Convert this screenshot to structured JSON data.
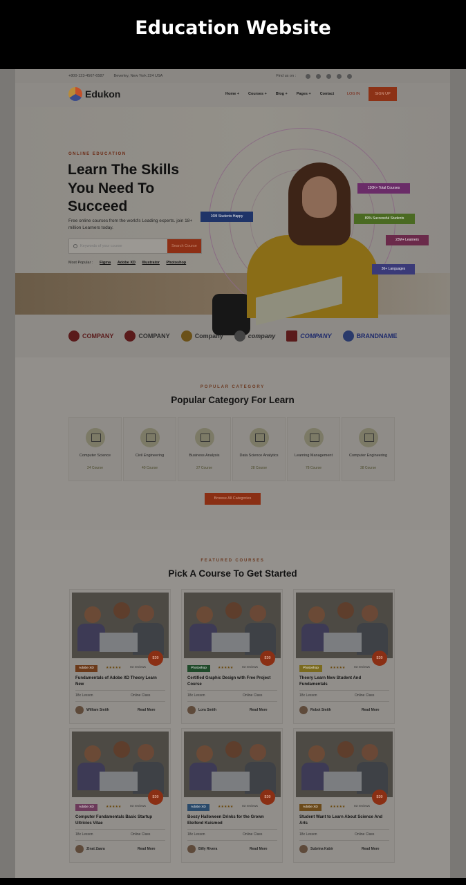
{
  "title_bar": "Education Website",
  "topbar": {
    "phone": "+800-123-4567-6587",
    "address": "Beverley, New York 224 USA",
    "find_us": "Find us on :"
  },
  "logo": "Edukon",
  "nav": [
    "Home +",
    "Courses +",
    "Blog +",
    "Pages +",
    "Contact"
  ],
  "login": "LOG IN",
  "signup": "SIGN UP",
  "hero": {
    "kicker": "ONLINE EDUCATION",
    "headline": "Learn The Skills You Need To Succeed",
    "lead": "Free online courses from the world's Leading experts. join 18+ million Learners today.",
    "search_placeholder": "Keywords of your course",
    "search_button": "Search Course",
    "popular_label": "Most Popular :",
    "popular": [
      "Figma",
      "Adobe XD",
      "Illustrator",
      "Photoshop"
    ],
    "tags": [
      "16M Students Happy",
      "130K+ Total Courses",
      "89% Successful Students",
      "23M+ Learners",
      "36+ Languages"
    ]
  },
  "brands": [
    "COMPANY",
    "COMPANY",
    "Company",
    "company",
    "COMPANY",
    "BRANDNAME"
  ],
  "categories": {
    "kicker": "POPULAR CATEGORY",
    "title": "Popular Category For Learn",
    "items": [
      {
        "name": "Computer Science",
        "count": "24 Course"
      },
      {
        "name": "Civil Engineering",
        "count": "40 Course"
      },
      {
        "name": "Business Analysis",
        "count": "27 Course"
      },
      {
        "name": "Data Science Analytics",
        "count": "28 Course"
      },
      {
        "name": "Learning Management",
        "count": "78 Course"
      },
      {
        "name": "Computer Engineering",
        "count": "38 Course"
      }
    ],
    "browse": "Browse All Categories"
  },
  "courses": {
    "kicker": "FEATURED COURSES",
    "title": "Pick A Course To Get Started",
    "items": [
      {
        "badge": "Adobe XD",
        "reviews": "03 reviews",
        "title": "Fundamentals of Adobe XD Theory Learn New",
        "lessons": "18x Lesson",
        "mode": "Online Class",
        "author": "William Smith",
        "more": "Read More",
        "price": "$30",
        "badge_color": "#6b3a1a"
      },
      {
        "badge": "Photoshop",
        "reviews": "03 reviews",
        "title": "Certified Graphic Design with Free Project Course",
        "lessons": "18x Lesson",
        "mode": "Online Class",
        "author": "Lora Smith",
        "more": "Read More",
        "price": "$30",
        "badge_color": "#1f4a2a"
      },
      {
        "badge": "Photoshop",
        "reviews": "03 reviews",
        "title": "Theory Learn New Student And Fundamentals",
        "lessons": "18x Lesson",
        "mode": "Online Class",
        "author": "Robot Smith",
        "more": "Read More",
        "price": "$30",
        "badge_color": "#7a6a1e"
      },
      {
        "badge": "Adobe XD",
        "reviews": "03 reviews",
        "title": "Computer Fundamentals Basic Startup Ultricies Vitae",
        "lessons": "18x Lesson",
        "mode": "Online Class",
        "author": "Zinat Zaara",
        "more": "Read More",
        "price": "$30",
        "badge_color": "#6b3a5a"
      },
      {
        "badge": "Adobe XD",
        "reviews": "03 reviews",
        "title": "Boozy Halloween Drinks for the Grown Eleifend Kuismod",
        "lessons": "18x Lesson",
        "mode": "Online Class",
        "author": "Billy Rivera",
        "more": "Read More",
        "price": "$30",
        "badge_color": "#2a4a6a"
      },
      {
        "badge": "Adobe XD",
        "reviews": "03 reviews",
        "title": "Student Want to Learn About Science And Arts",
        "lessons": "18x Lesson",
        "mode": "Online Class",
        "author": "Subrina Kabir",
        "more": "Read More",
        "price": "$30",
        "badge_color": "#6b4a1a"
      }
    ]
  }
}
